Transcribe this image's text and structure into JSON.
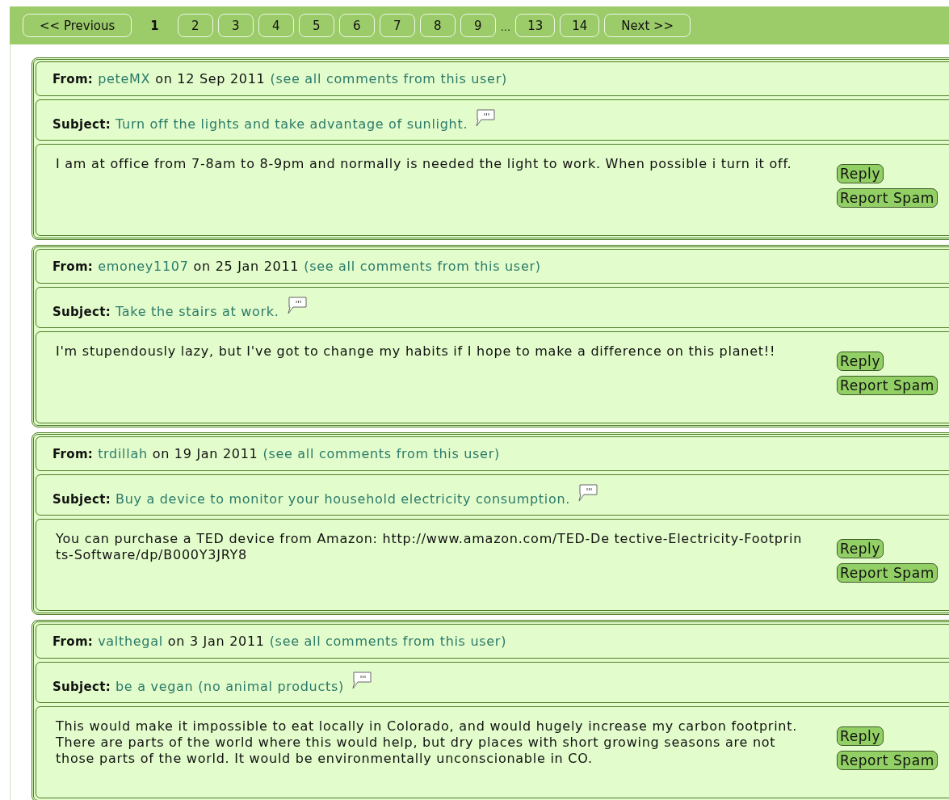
{
  "pagination": [
    {
      "kind": "prev",
      "label": "<< Previous"
    },
    {
      "kind": "page",
      "label": "1",
      "selected": true
    },
    {
      "kind": "page",
      "label": "2",
      "selected": false
    },
    {
      "kind": "page",
      "label": "3",
      "selected": false
    },
    {
      "kind": "page",
      "label": "4",
      "selected": false
    },
    {
      "kind": "page",
      "label": "5",
      "selected": false
    },
    {
      "kind": "page",
      "label": "6",
      "selected": false
    },
    {
      "kind": "page",
      "label": "7",
      "selected": false
    },
    {
      "kind": "page",
      "label": "8",
      "selected": false
    },
    {
      "kind": "page",
      "label": "9",
      "selected": false
    },
    {
      "kind": "ellipsis",
      "label": "..."
    },
    {
      "kind": "page",
      "label": "13",
      "selected": false
    },
    {
      "kind": "page",
      "label": "14",
      "selected": false
    },
    {
      "kind": "next",
      "label": "Next >>"
    }
  ],
  "comments": [
    {
      "from_label": "From:",
      "user": "peteMX",
      "date": "on 12 Sep 2011",
      "see_all": "(see all comments from this user)",
      "subject_label": "Subject:",
      "subject": "Turn off the lights and take advantage of sunlight.",
      "body": "I am at office from 7-8am to 8-9pm and normally is needed the light to work. When possible i turn it off.",
      "buttons": [
        "Reply",
        "Report Spam"
      ]
    },
    {
      "from_label": "From:",
      "user": "emoney1107",
      "date": "on 25 Jan 2011",
      "see_all": "(see all comments from this user)",
      "subject_label": "Subject:",
      "subject": "Take the stairs at work.",
      "body": "I'm stupendously lazy, but I've got to change my habits if I hope to make a difference on this planet!!",
      "buttons": [
        "Reply",
        "Report Spam"
      ]
    },
    {
      "from_label": "From:",
      "user": "trdillah",
      "date": "on 19 Jan 2011",
      "see_all": "(see all comments from this user)",
      "subject_label": "Subject:",
      "subject": "Buy a device to monitor your household electricity consumption.",
      "body": "You can purchase a TED device from Amazon: http://www.amazon.com/TED-De tective-Electricity-Footprin ts-Software/dp/B000Y3JRY8",
      "buttons": [
        "Reply",
        "Report Spam"
      ]
    },
    {
      "from_label": "From:",
      "user": "valthegal",
      "date": "on 3 Jan 2011",
      "see_all": "(see all comments from this user)",
      "subject_label": "Subject:",
      "subject": "be a vegan (no animal products)",
      "body": "This would make it impossible to eat locally in Colorado, and would hugely increase my carbon footprint. There are parts of the world where this would help, but dry places with short growing seasons are not those parts of the world. It would be environmentally unconscionable in CO.",
      "buttons": [
        "Reply",
        "Report Spam"
      ]
    }
  ]
}
